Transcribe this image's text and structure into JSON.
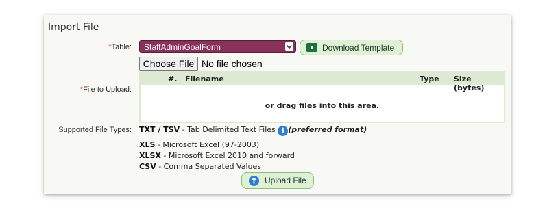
{
  "panel": {
    "title": "Import File"
  },
  "table_field": {
    "required_mark": "*",
    "label": "Table:",
    "selected": "StaffAdminGoalForm",
    "download_button": "Download Template",
    "download_icon": "excel-icon"
  },
  "file_field": {
    "required_mark": "*",
    "label": "File to Upload:",
    "choose_button": "Choose File",
    "status": "No file chosen",
    "columns": [
      "#.",
      "Filename",
      "Type",
      "Size (bytes)"
    ],
    "drop_message": "or drag files into this area."
  },
  "supported": {
    "label": "Supported File Types:",
    "items": [
      {
        "format": "TXT / TSV",
        "desc": " - Tab Delimited Text Files ",
        "note": "(preferred format)",
        "icon": "info-icon"
      },
      {
        "format": "XLS",
        "desc": " - Microsoft Excel (97-2003)"
      },
      {
        "format": "XLSX",
        "desc": " - Microsoft Excel 2010 and forward"
      },
      {
        "format": "CSV",
        "desc": " - Comma Separated Values"
      }
    ]
  },
  "upload_button": {
    "label": "Upload File",
    "icon": "upload-arrow-icon"
  },
  "colors": {
    "select_bg": "#8a3159",
    "button_bg": "#dff0d4",
    "grid_header": "#dde9d2",
    "info_blue": "#2b7fd1"
  }
}
